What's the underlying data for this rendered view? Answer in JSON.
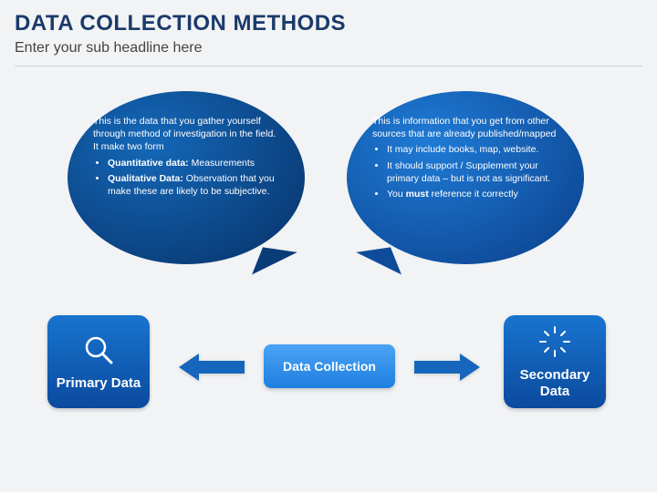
{
  "header": {
    "title": "DATA COLLECTION METHODS",
    "subtitle": "Enter your sub headline here"
  },
  "bubbles": {
    "primary": {
      "intro": "This is the data that you gather yourself through method of investigation in the field. It make two form",
      "bullets": [
        {
          "bold": "Quantitative data:",
          "rest": " Measurements"
        },
        {
          "bold": "Qualitative Data:",
          "rest": " Observation that you make these are likely to be subjective."
        }
      ]
    },
    "secondary": {
      "intro": "This is information that you get from other sources that are already published/mapped",
      "bullets": [
        {
          "plain": "It may include books, map, website."
        },
        {
          "plain": "It should support / Supplement your primary data – but is not as significant."
        },
        {
          "pre": "You ",
          "bold": "must",
          "rest": " reference it correctly"
        }
      ]
    }
  },
  "nodes": {
    "center": "Data Collection",
    "primary": "Primary Data",
    "secondary": "Secondary Data"
  },
  "icons": {
    "primary": "magnifier-icon",
    "secondary": "radial-dots-icon"
  },
  "colors": {
    "brand_dark": "#0b4a9e",
    "brand_mid": "#1874cf",
    "brand_light": "#4ba3f3",
    "title": "#1a3a6a"
  },
  "legal": ""
}
